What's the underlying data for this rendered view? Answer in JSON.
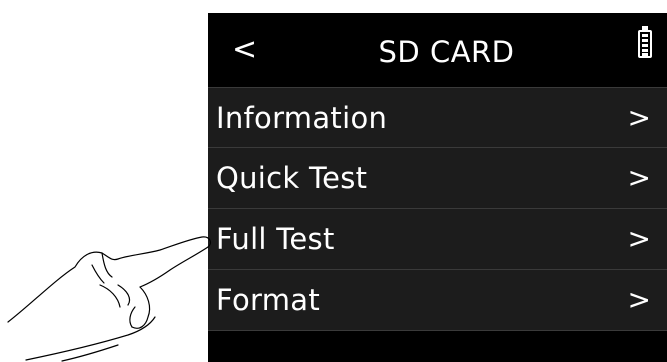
{
  "header": {
    "back_glyph": "<",
    "title": "SD CARD",
    "battery_icon": "battery-full-icon"
  },
  "menu": {
    "items": [
      {
        "label": "Information",
        "chevron": ">"
      },
      {
        "label": "Quick Test",
        "chevron": ">"
      },
      {
        "label": "Full Test",
        "chevron": ">"
      },
      {
        "label": "Format",
        "chevron": ">"
      }
    ]
  },
  "colors": {
    "screen_bg": "#000000",
    "row_bg": "#1c1c1c",
    "divider": "#3a3a3a",
    "text": "#ffffff"
  }
}
